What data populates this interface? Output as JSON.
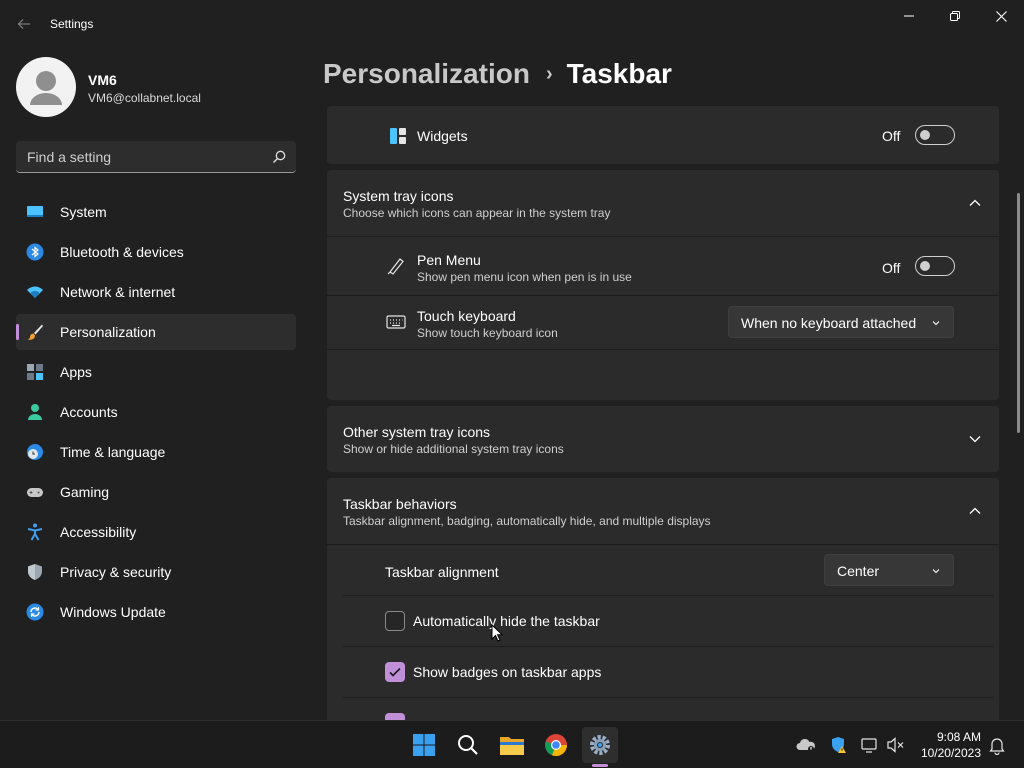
{
  "window": {
    "title": "Settings"
  },
  "user": {
    "name": "VM6",
    "email": "VM6@collabnet.local"
  },
  "search": {
    "placeholder": "Find a setting"
  },
  "sidebar": {
    "items": [
      {
        "label": "System",
        "icon": "system-icon"
      },
      {
        "label": "Bluetooth & devices",
        "icon": "bluetooth-icon"
      },
      {
        "label": "Network & internet",
        "icon": "wifi-icon"
      },
      {
        "label": "Personalization",
        "icon": "brush-icon",
        "selected": true
      },
      {
        "label": "Apps",
        "icon": "apps-icon"
      },
      {
        "label": "Accounts",
        "icon": "accounts-icon"
      },
      {
        "label": "Time & language",
        "icon": "globe-clock-icon"
      },
      {
        "label": "Gaming",
        "icon": "gamepad-icon"
      },
      {
        "label": "Accessibility",
        "icon": "accessibility-icon"
      },
      {
        "label": "Privacy & security",
        "icon": "shield-icon"
      },
      {
        "label": "Windows Update",
        "icon": "update-icon"
      }
    ]
  },
  "breadcrumb": {
    "parent": "Personalization",
    "separator": "›",
    "current": "Taskbar"
  },
  "widgets": {
    "label": "Widgets",
    "state": "Off"
  },
  "system_tray": {
    "title": "System tray icons",
    "subtitle": "Choose which icons can appear in the system tray",
    "pen_menu": {
      "title": "Pen Menu",
      "subtitle": "Show pen menu icon when pen is in use",
      "state": "Off"
    },
    "touch_keyboard": {
      "title": "Touch keyboard",
      "subtitle": "Show touch keyboard icon",
      "value": "When no keyboard attached"
    }
  },
  "other_tray": {
    "title": "Other system tray icons",
    "subtitle": "Show or hide additional system tray icons"
  },
  "behaviors": {
    "title": "Taskbar behaviors",
    "subtitle": "Taskbar alignment, badging, automatically hide, and multiple displays",
    "alignment_label": "Taskbar alignment",
    "alignment_value": "Center",
    "auto_hide": {
      "label": "Automatically hide the taskbar",
      "checked": false
    },
    "badges": {
      "label": "Show badges on taskbar apps",
      "checked": true
    }
  },
  "taskbar": {
    "apps": [
      "start-icon",
      "search-icon",
      "file-explorer-icon",
      "chrome-icon",
      "settings-icon"
    ],
    "time": "9:08 AM",
    "date": "10/20/2023"
  },
  "colors": {
    "accent": "#c08fd8",
    "background": "#202020",
    "card": "#2b2b2b"
  }
}
